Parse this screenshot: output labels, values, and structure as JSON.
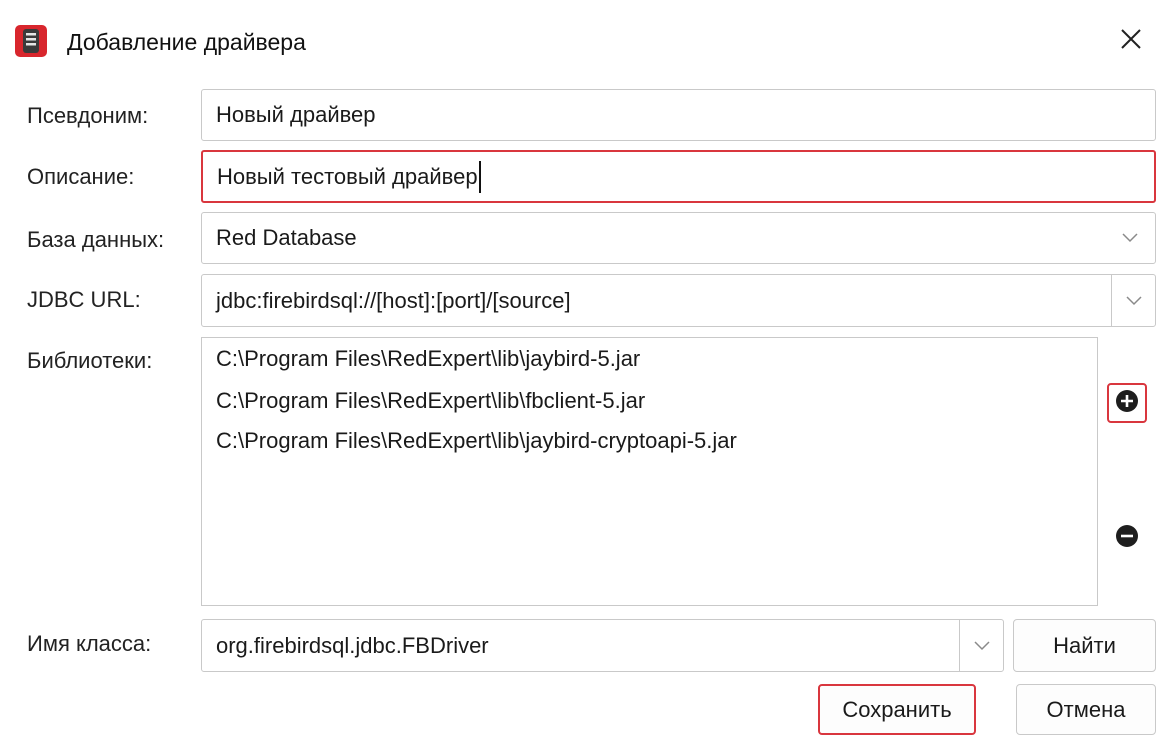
{
  "window": {
    "title": "Добавление драйвера",
    "app_icon": "red-expert-icon",
    "close_icon": "close-icon"
  },
  "form": {
    "alias": {
      "label": "Псевдоним:",
      "value": "Новый драйвер"
    },
    "description": {
      "label": "Описание:",
      "value": "Новый тестовый драйвер"
    },
    "database": {
      "label": "База данных:",
      "value": "Red Database"
    },
    "jdbc_url": {
      "label": "JDBC URL:",
      "value": "jdbc:firebirdsql://[host]:[port]/[source]"
    },
    "libraries": {
      "label": "Библиотеки:",
      "items": [
        "C:\\Program Files\\RedExpert\\lib\\jaybird-5.jar",
        "C:\\Program Files\\RedExpert\\lib\\fbclient-5.jar",
        "C:\\Program Files\\RedExpert\\lib\\jaybird-cryptoapi-5.jar"
      ],
      "add_icon": "plus-circle-icon",
      "remove_icon": "minus-circle-icon"
    },
    "class_name": {
      "label": "Имя класса:",
      "value": "org.firebirdsql.jdbc.FBDriver",
      "find_label": "Найти"
    }
  },
  "actions": {
    "save_label": "Сохранить",
    "cancel_label": "Отмена"
  },
  "colors": {
    "accent": "#d9363e",
    "border": "#c9c9c9"
  }
}
